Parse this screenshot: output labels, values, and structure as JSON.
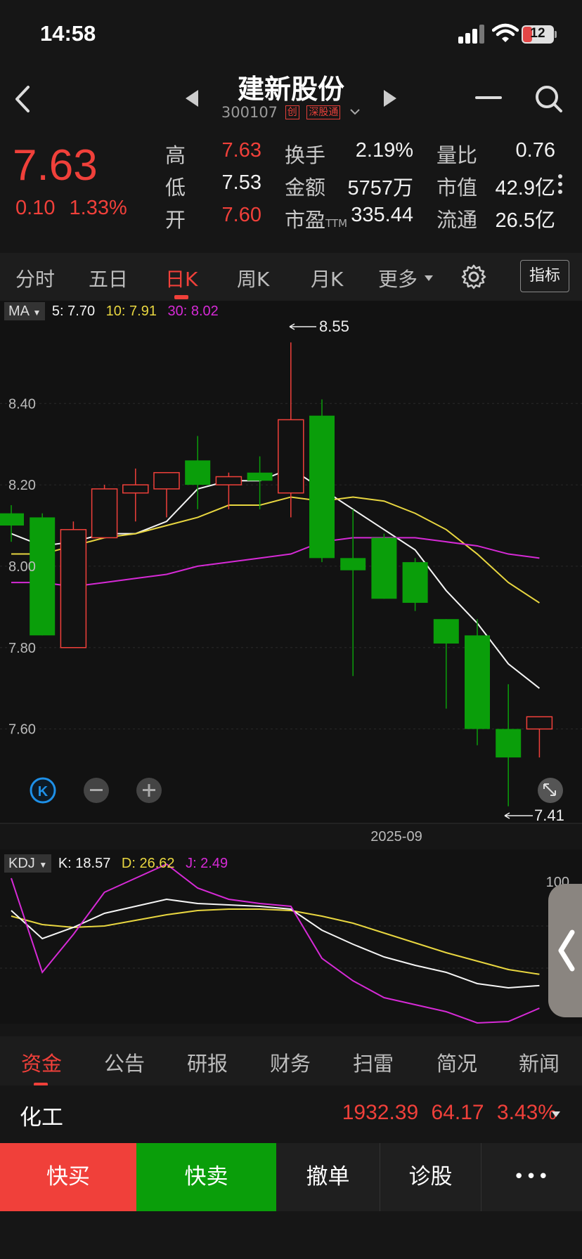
{
  "status": {
    "time": "14:58",
    "battery": "12"
  },
  "header": {
    "title": "建新股份",
    "code": "300107",
    "tags": [
      "创",
      "深股通"
    ]
  },
  "quote": {
    "price": "7.63",
    "change": "0.10",
    "change_pct": "1.33%",
    "fields": [
      {
        "label": "高",
        "value": "7.63",
        "color": "#f0403a"
      },
      {
        "label": "低",
        "value": "7.53",
        "color": "#f2f2f2"
      },
      {
        "label": "开",
        "value": "7.60",
        "color": "#f0403a"
      },
      {
        "label": "换手",
        "value": "2.19%",
        "color": "#f2f2f2"
      },
      {
        "label": "金额",
        "value": "5757万",
        "color": "#f2f2f2"
      },
      {
        "label": "市盈",
        "label_sub": "TTM",
        "value": "335.44",
        "color": "#f2f2f2"
      },
      {
        "label": "量比",
        "value": "0.76",
        "color": "#f2f2f2"
      },
      {
        "label": "市值",
        "value": "42.9亿",
        "color": "#f2f2f2"
      },
      {
        "label": "流通",
        "value": "26.5亿",
        "color": "#f2f2f2"
      }
    ]
  },
  "tabs": [
    "分时",
    "五日",
    "日K",
    "周K",
    "月K",
    "更多"
  ],
  "active_tab": "日K",
  "indicator_button": "指标",
  "ma_legend": {
    "name": "MA",
    "ma5": "5: 7.70",
    "ma10": "10: 7.91",
    "ma30": "30: 8.02"
  },
  "kdj_legend": {
    "name": "KDJ",
    "k": "K: 18.57",
    "d": "D: 26.62",
    "j": "J: 2.49"
  },
  "kdj_top_label": "100",
  "chart_data": {
    "type": "candlestick",
    "x_label": "2025-09",
    "y_ticks": [
      "8.40",
      "8.20",
      "8.00",
      "7.80",
      "7.60"
    ],
    "ylim": [
      7.38,
      8.58
    ],
    "max_label": "8.55",
    "min_label": "7.41",
    "candles": [
      {
        "o": 8.13,
        "c": 8.1,
        "h": 8.15,
        "l": 8.06
      },
      {
        "o": 8.12,
        "c": 7.83,
        "h": 8.13,
        "l": 7.83
      },
      {
        "o": 7.8,
        "c": 8.09,
        "h": 8.11,
        "l": 7.8
      },
      {
        "o": 8.07,
        "c": 8.19,
        "h": 8.2,
        "l": 8.07
      },
      {
        "o": 8.18,
        "c": 8.2,
        "h": 8.24,
        "l": 8.11
      },
      {
        "o": 8.19,
        "c": 8.23,
        "h": 8.23,
        "l": 8.12
      },
      {
        "o": 8.26,
        "c": 8.2,
        "h": 8.32,
        "l": 8.14
      },
      {
        "o": 8.2,
        "c": 8.22,
        "h": 8.23,
        "l": 8.14
      },
      {
        "o": 8.23,
        "c": 8.21,
        "h": 8.27,
        "l": 8.14
      },
      {
        "o": 8.18,
        "c": 8.36,
        "h": 8.55,
        "l": 8.12
      },
      {
        "o": 8.37,
        "c": 8.02,
        "h": 8.41,
        "l": 8.01
      },
      {
        "o": 8.02,
        "c": 7.99,
        "h": 8.14,
        "l": 7.73
      },
      {
        "o": 8.07,
        "c": 7.92,
        "h": 8.08,
        "l": 7.92
      },
      {
        "o": 8.01,
        "c": 7.91,
        "h": 8.02,
        "l": 7.89
      },
      {
        "o": 7.87,
        "c": 7.81,
        "h": 7.87,
        "l": 7.65
      },
      {
        "o": 7.83,
        "c": 7.6,
        "h": 7.87,
        "l": 7.56
      },
      {
        "o": 7.6,
        "c": 7.53,
        "h": 7.71,
        "l": 7.41
      },
      {
        "o": 7.6,
        "c": 7.63,
        "h": 7.63,
        "l": 7.53
      }
    ],
    "series": [
      {
        "name": "MA5",
        "color": "#f5f5f5",
        "values": [
          8.08,
          8.05,
          8.06,
          8.08,
          8.08,
          8.11,
          8.19,
          8.21,
          8.21,
          8.24,
          8.19,
          8.14,
          8.09,
          8.04,
          7.94,
          7.86,
          7.76,
          7.7
        ]
      },
      {
        "name": "MA10",
        "color": "#e8d640",
        "values": [
          8.03,
          8.03,
          8.05,
          8.07,
          8.08,
          8.1,
          8.12,
          8.15,
          8.15,
          8.17,
          8.16,
          8.17,
          8.16,
          8.13,
          8.09,
          8.03,
          7.96,
          7.91
        ]
      },
      {
        "name": "MA30",
        "color": "#d62ad6",
        "values": [
          7.96,
          7.96,
          7.95,
          7.96,
          7.97,
          7.98,
          8.0,
          8.01,
          8.02,
          8.03,
          8.06,
          8.07,
          8.07,
          8.07,
          8.06,
          8.05,
          8.03,
          8.02
        ]
      }
    ],
    "kdj": {
      "ylim": [
        0,
        100
      ],
      "K": [
        72,
        52,
        60,
        70,
        75,
        80,
        77,
        76,
        75,
        73,
        58,
        48,
        39,
        33,
        28,
        20,
        17,
        18.57
      ],
      "D": [
        68,
        62,
        60,
        61,
        65,
        69,
        72,
        73,
        73,
        72,
        68,
        63,
        56,
        49,
        42,
        36,
        30,
        26.62
      ],
      "J": [
        95,
        28,
        55,
        85,
        95,
        105,
        88,
        80,
        77,
        75,
        38,
        22,
        10,
        5,
        0,
        -8,
        -7,
        2.49
      ]
    },
    "colors": {
      "up": "#f0403a",
      "down": "#0a9e0a",
      "K": "#f5f5f5",
      "D": "#e8d640",
      "J": "#d62ad6"
    }
  },
  "bottom_tabs": [
    "资金",
    "公告",
    "研报",
    "财务",
    "扫雷",
    "简况",
    "新闻"
  ],
  "active_bottom_tab": "资金",
  "sector": {
    "name": "化工",
    "value": "1932.39",
    "change": "64.17",
    "change_pct": "3.43%"
  },
  "actions": {
    "buy": "快买",
    "sell": "快卖",
    "cancel": "撤单",
    "diagnose": "诊股",
    "more": "•••"
  }
}
